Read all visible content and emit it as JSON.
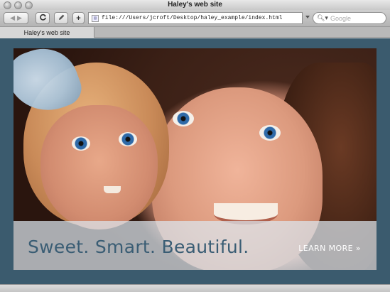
{
  "window": {
    "title": "Haley's web site"
  },
  "toolbar": {
    "back_icon": "back-arrow-icon",
    "forward_icon": "forward-arrow-icon",
    "reload_glyph": "C",
    "add_glyph": "+",
    "url": "file:///Users/jcroft/Desktop/haley_example/index.html",
    "search_placeholder": "Google"
  },
  "tabs": [
    {
      "label": "Haley's web site",
      "active": true
    }
  ],
  "hero": {
    "tagline": "Sweet. Smart. Beautiful.",
    "cta": "LEARN MORE »"
  },
  "colors": {
    "page_background": "#3b5b6e",
    "tagline": "#3a5d74",
    "overlay": "#dce8f0"
  }
}
